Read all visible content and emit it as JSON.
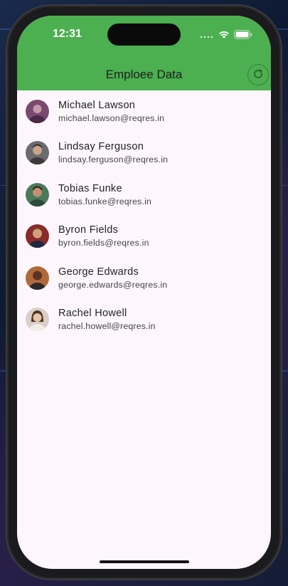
{
  "status_bar": {
    "time": "12:31"
  },
  "app_bar": {
    "title": "Emploee Data",
    "background_color": "#4caf50",
    "refresh_icon": "refresh-icon"
  },
  "employees": [
    {
      "name": "Michael Lawson",
      "email": "michael.lawson@reqres.in",
      "avatar_color": "#7a4a6e"
    },
    {
      "name": "Lindsay Ferguson",
      "email": "lindsay.ferguson@reqres.in",
      "avatar_color": "#6b6b6b"
    },
    {
      "name": "Tobias Funke",
      "email": "tobias.funke@reqres.in",
      "avatar_color": "#4a7a5a"
    },
    {
      "name": "Byron Fields",
      "email": "byron.fields@reqres.in",
      "avatar_color": "#8a2a2a"
    },
    {
      "name": "George Edwards",
      "email": "george.edwards@reqres.in",
      "avatar_color": "#b06a3a"
    },
    {
      "name": "Rachel Howell",
      "email": "rachel.howell@reqres.in",
      "avatar_color": "#d9cfc7"
    }
  ]
}
